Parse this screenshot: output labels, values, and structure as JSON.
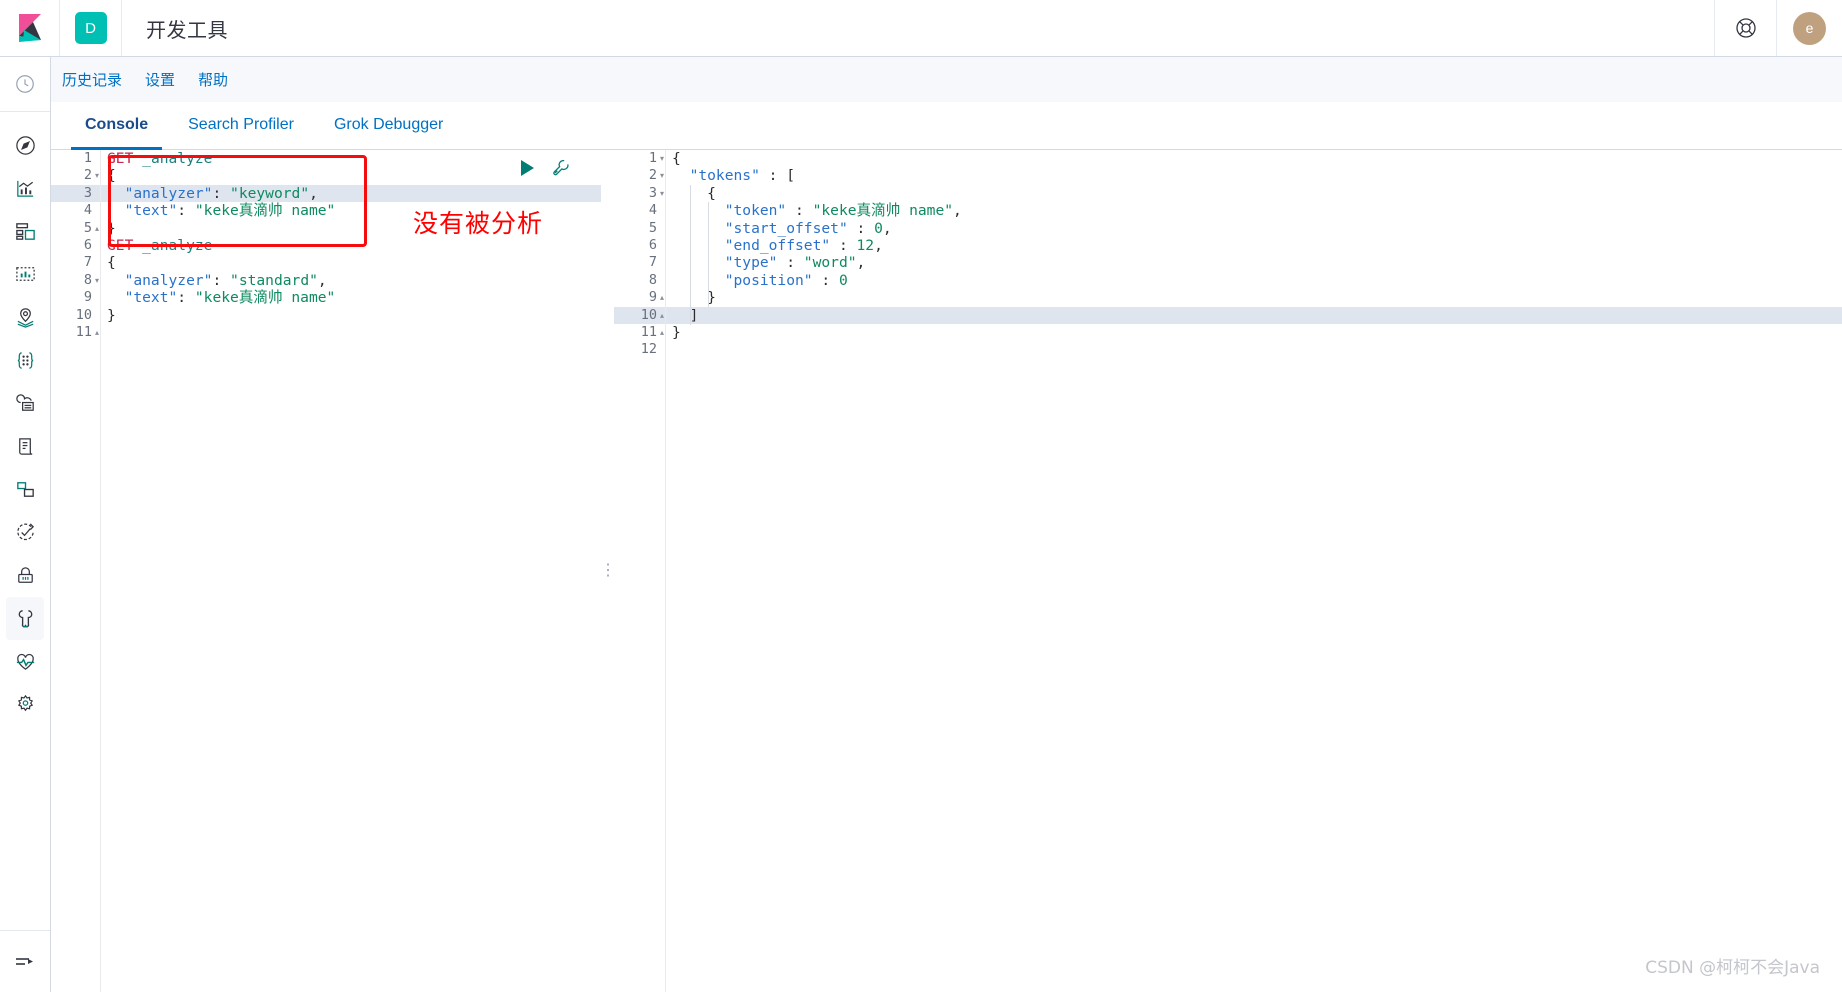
{
  "header": {
    "logo_icon": "kibana-logo",
    "space_badge": "D",
    "title": "开发工具",
    "help_icon": "help-life-ring-icon",
    "avatar_initial": "e"
  },
  "sidebar": {
    "recent_icon": "recently-viewed-clock-icon",
    "items": [
      {
        "icon": "discover-compass-icon",
        "name": "discover"
      },
      {
        "icon": "visualize-chart-icon",
        "name": "visualize"
      },
      {
        "icon": "dashboard-grid-icon",
        "name": "dashboard"
      },
      {
        "icon": "canvas-icon",
        "name": "canvas"
      },
      {
        "icon": "maps-pin-icon",
        "name": "maps"
      },
      {
        "icon": "machine-learning-icon",
        "name": "machine-learning"
      },
      {
        "icon": "infrastructure-cloud-icon",
        "name": "infrastructure"
      },
      {
        "icon": "logs-document-icon",
        "name": "logs"
      },
      {
        "icon": "apm-layers-icon",
        "name": "apm"
      },
      {
        "icon": "siem-check-icon",
        "name": "siem"
      },
      {
        "icon": "security-lock-icon",
        "name": "security"
      },
      {
        "icon": "dev-tools-wrench-icon",
        "name": "dev-tools",
        "selected": true
      },
      {
        "icon": "uptime-heartbeat-icon",
        "name": "uptime"
      },
      {
        "icon": "management-gear-icon",
        "name": "management"
      }
    ],
    "collapse_icon": "collapse-arrow-icon"
  },
  "navstrip": {
    "links": [
      {
        "label": "历史记录",
        "name": "history"
      },
      {
        "label": "设置",
        "name": "settings"
      },
      {
        "label": "帮助",
        "name": "help"
      }
    ]
  },
  "tabs": [
    {
      "label": "Console",
      "name": "console",
      "active": true
    },
    {
      "label": "Search Profiler",
      "name": "search-profiler",
      "active": false
    },
    {
      "label": "Grok Debugger",
      "name": "grok-debugger",
      "active": false
    }
  ],
  "editor": {
    "play_icon": "play-send-request-icon",
    "wrench_icon": "wrench-open-docs-icon",
    "annotation_label": "没有被分析",
    "drag_icon": "drag-handle-icon",
    "request_lines": [
      {
        "n": 1,
        "fold": "",
        "highlight": false,
        "tokens": [
          {
            "t": "GET ",
            "c": "k-method"
          },
          {
            "t": "_analyze",
            "c": "k-url"
          }
        ]
      },
      {
        "n": 2,
        "fold": "▾",
        "highlight": false,
        "tokens": [
          {
            "t": "{",
            "c": "k-brace"
          }
        ]
      },
      {
        "n": 3,
        "fold": "",
        "highlight": true,
        "tokens": [
          {
            "t": "  ",
            "c": "k-punc"
          },
          {
            "t": "\"analyzer\"",
            "c": "k-key"
          },
          {
            "t": ": ",
            "c": "k-punc"
          },
          {
            "t": "\"keyword\"",
            "c": "k-str"
          },
          {
            "t": ",",
            "c": "k-punc"
          }
        ]
      },
      {
        "n": 4,
        "fold": "",
        "highlight": false,
        "tokens": [
          {
            "t": "  ",
            "c": "k-punc"
          },
          {
            "t": "\"text\"",
            "c": "k-key"
          },
          {
            "t": ": ",
            "c": "k-punc"
          },
          {
            "t": "\"keke真滴帅 name\"",
            "c": "k-str"
          }
        ]
      },
      {
        "n": 5,
        "fold": "▴",
        "highlight": false,
        "tokens": [
          {
            "t": "}",
            "c": "k-brace"
          }
        ]
      },
      {
        "n": 6,
        "fold": "",
        "highlight": false,
        "tokens": [
          {
            "t": "",
            "c": "k-punc"
          }
        ]
      },
      {
        "n": 7,
        "fold": "",
        "highlight": false,
        "tokens": [
          {
            "t": "GET ",
            "c": "k-method"
          },
          {
            "t": "_analyze",
            "c": "k-url"
          }
        ]
      },
      {
        "n": 8,
        "fold": "▾",
        "highlight": false,
        "tokens": [
          {
            "t": "{",
            "c": "k-brace"
          }
        ]
      },
      {
        "n": 9,
        "fold": "",
        "highlight": false,
        "tokens": [
          {
            "t": "  ",
            "c": "k-punc"
          },
          {
            "t": "\"analyzer\"",
            "c": "k-key"
          },
          {
            "t": ": ",
            "c": "k-punc"
          },
          {
            "t": "\"standard\"",
            "c": "k-str"
          },
          {
            "t": ",",
            "c": "k-punc"
          }
        ]
      },
      {
        "n": 10,
        "fold": "",
        "highlight": false,
        "tokens": [
          {
            "t": "  ",
            "c": "k-punc"
          },
          {
            "t": "\"text\"",
            "c": "k-key"
          },
          {
            "t": ": ",
            "c": "k-punc"
          },
          {
            "t": "\"keke真滴帅 name\"",
            "c": "k-str"
          }
        ]
      },
      {
        "n": 11,
        "fold": "▴",
        "highlight": false,
        "tokens": [
          {
            "t": "}",
            "c": "k-brace"
          }
        ]
      }
    ],
    "response_lines": [
      {
        "n": 1,
        "fold": "▾",
        "highlight": false,
        "tokens": [
          {
            "t": "{",
            "c": "k-brace"
          }
        ]
      },
      {
        "n": 2,
        "fold": "▾",
        "highlight": false,
        "tokens": [
          {
            "t": "  ",
            "c": "k-punc"
          },
          {
            "t": "\"tokens\"",
            "c": "k-key"
          },
          {
            "t": " : ",
            "c": "k-punc"
          },
          {
            "t": "[",
            "c": "k-brace"
          }
        ]
      },
      {
        "n": 3,
        "fold": "▾",
        "highlight": false,
        "tokens": [
          {
            "t": "    ",
            "c": "k-punc"
          },
          {
            "t": "{",
            "c": "k-brace"
          }
        ]
      },
      {
        "n": 4,
        "fold": "",
        "highlight": false,
        "tokens": [
          {
            "t": "      ",
            "c": "k-punc"
          },
          {
            "t": "\"token\"",
            "c": "k-key"
          },
          {
            "t": " : ",
            "c": "k-punc"
          },
          {
            "t": "\"keke真滴帅 name\"",
            "c": "k-str"
          },
          {
            "t": ",",
            "c": "k-punc"
          }
        ]
      },
      {
        "n": 5,
        "fold": "",
        "highlight": false,
        "tokens": [
          {
            "t": "      ",
            "c": "k-punc"
          },
          {
            "t": "\"start_offset\"",
            "c": "k-key"
          },
          {
            "t": " : ",
            "c": "k-punc"
          },
          {
            "t": "0",
            "c": "k-num"
          },
          {
            "t": ",",
            "c": "k-punc"
          }
        ]
      },
      {
        "n": 6,
        "fold": "",
        "highlight": false,
        "tokens": [
          {
            "t": "      ",
            "c": "k-punc"
          },
          {
            "t": "\"end_offset\"",
            "c": "k-key"
          },
          {
            "t": " : ",
            "c": "k-punc"
          },
          {
            "t": "12",
            "c": "k-num"
          },
          {
            "t": ",",
            "c": "k-punc"
          }
        ]
      },
      {
        "n": 7,
        "fold": "",
        "highlight": false,
        "tokens": [
          {
            "t": "      ",
            "c": "k-punc"
          },
          {
            "t": "\"type\"",
            "c": "k-key"
          },
          {
            "t": " : ",
            "c": "k-punc"
          },
          {
            "t": "\"word\"",
            "c": "k-str"
          },
          {
            "t": ",",
            "c": "k-punc"
          }
        ]
      },
      {
        "n": 8,
        "fold": "",
        "highlight": false,
        "tokens": [
          {
            "t": "      ",
            "c": "k-punc"
          },
          {
            "t": "\"position\"",
            "c": "k-key"
          },
          {
            "t": " : ",
            "c": "k-punc"
          },
          {
            "t": "0",
            "c": "k-num"
          }
        ]
      },
      {
        "n": 9,
        "fold": "▴",
        "highlight": false,
        "tokens": [
          {
            "t": "    ",
            "c": "k-punc"
          },
          {
            "t": "}",
            "c": "k-brace"
          }
        ]
      },
      {
        "n": 10,
        "fold": "▴",
        "highlight": true,
        "tokens": [
          {
            "t": "  ",
            "c": "k-punc"
          },
          {
            "t": "]",
            "c": "k-brace"
          }
        ]
      },
      {
        "n": 11,
        "fold": "▴",
        "highlight": false,
        "tokens": [
          {
            "t": "}",
            "c": "k-brace"
          }
        ]
      },
      {
        "n": 12,
        "fold": "",
        "highlight": false,
        "tokens": [
          {
            "t": "",
            "c": "k-punc"
          }
        ]
      }
    ]
  },
  "watermark": "CSDN @柯柯不会Java",
  "colors": {
    "accent": "#00BFB3",
    "link": "#0071c2",
    "annotation_red": "#ff0000",
    "avatar": "#BFA180"
  }
}
